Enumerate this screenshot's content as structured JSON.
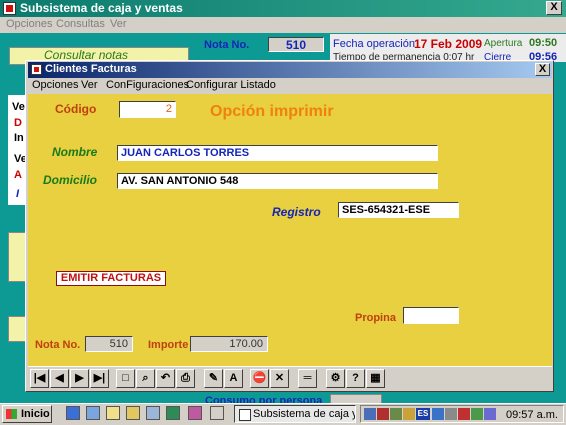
{
  "main_window": {
    "title": "Subsistema de caja y ventas",
    "close": "X",
    "menu": [
      "Opciones",
      "Consultas",
      "Ver"
    ],
    "consultar": "Consultar notas",
    "nota_label": "Nota No.",
    "nota_value": "510",
    "fecha_label": "Fecha operación",
    "fecha_value": "17 Feb 2009",
    "apertura_label": "Apertura",
    "apertura_value": "09:50",
    "tiempo_label": "Tiempo de permanencia",
    "tiempo_value": "0:07 hr",
    "cierre_label": "Cierre",
    "cierre_value": "09:56",
    "consumo_label": "Consumo por persona",
    "left_letters": [
      "Ve",
      "D",
      "In",
      "Ve",
      "A",
      "I"
    ]
  },
  "dialog": {
    "title": "Clientes Facturas",
    "close": "X",
    "menu": [
      "Opciones",
      "Ver",
      "ConFiguraciones",
      "Configurar Listado"
    ],
    "codigo_label": "Código",
    "codigo_value": "2",
    "opcion_label": "Opción imprimir",
    "nombre_label": "Nombre",
    "nombre_value": "JUAN CARLOS TORRES",
    "domicilio_label": "Domicilio",
    "domicilio_value": "AV. SAN ANTONIO 548",
    "registro_label": "Registro",
    "registro_value": "SES-654321-ESE",
    "emitir_label": "EMITIR FACTURAS",
    "propina_label": "Propina",
    "propina_value": "",
    "nota_label": "Nota No.",
    "nota_value": "510",
    "importe_label": "Importe",
    "importe_value": "170.00"
  },
  "toolbar": {
    "first": "|◀",
    "prev": "◀",
    "next": "▶",
    "last": "▶|",
    "new": "□",
    "binoculars": "⌕",
    "undo": "↶",
    "print": "⎙",
    "edit": "✎",
    "font": "A",
    "stop": "⛔",
    "delete": "✕",
    "equals": "═",
    "props": "⚙",
    "help": "?",
    "calc": "▦"
  },
  "taskbar": {
    "start_label": "Inicio",
    "task_label": "Subsistema de caja y...",
    "tray_lang": "ES",
    "clock": "09:57 a.m."
  }
}
